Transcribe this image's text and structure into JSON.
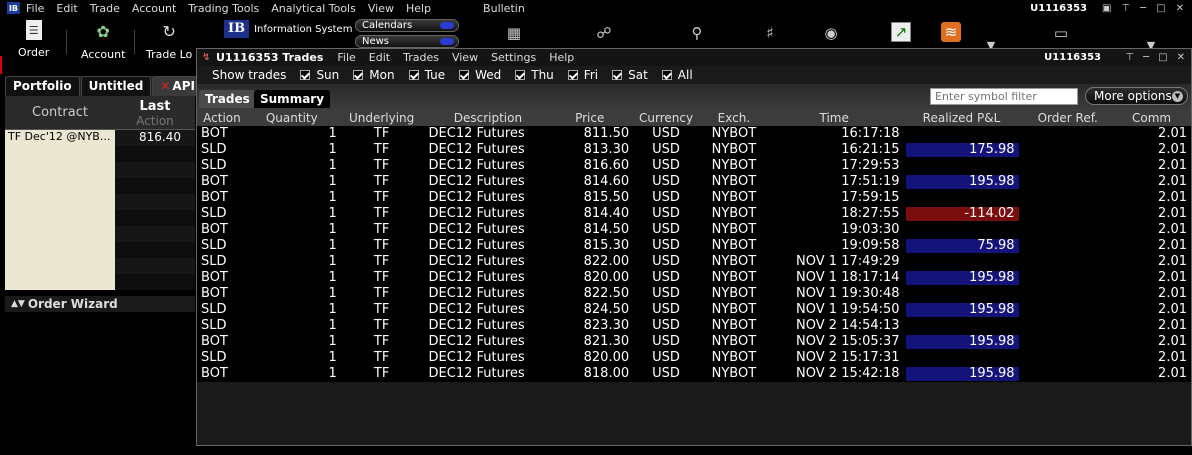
{
  "menubar": {
    "logo": "IB",
    "items": [
      "File",
      "Edit",
      "Trade",
      "Account",
      "Trading Tools",
      "Analytical Tools",
      "View",
      "Help"
    ],
    "bulletin": "Bulletin",
    "account": "U1116353"
  },
  "toolbar": {
    "order_label": "Order",
    "account_label": "Account",
    "tradelog_label": "Trade Lo",
    "ib_badge": "IB",
    "ib_info": "Information System",
    "calendars": "Calendars",
    "news": "News"
  },
  "left": {
    "tabs": [
      "Portfolio",
      "Untitled",
      "API"
    ],
    "header_contract": "Contract",
    "header_last": "Last",
    "header_action": "Action",
    "row_contract": "TF Dec'12 @NYB...",
    "row_last": "816.40",
    "order_wizard": "Order Wizard"
  },
  "trades_window": {
    "title": "U1116353 Trades",
    "menu": [
      "File",
      "Edit",
      "Trades",
      "View",
      "Settings",
      "Help"
    ],
    "account": "U1116353",
    "show_trades_label": "Show trades",
    "days": [
      "Sun",
      "Mon",
      "Tue",
      "Wed",
      "Thu",
      "Fri",
      "Sat",
      "All"
    ],
    "tabs": [
      "Trades",
      "Summary"
    ],
    "symbol_filter_placeholder": "Enter symbol filter",
    "more_options": "More options",
    "columns": [
      "Action",
      "Quantity",
      "Underlying",
      "Description",
      "Price",
      "Currency",
      "Exch.",
      "Time",
      "Realized P&L",
      "Order Ref.",
      "Comm"
    ],
    "rows": [
      {
        "action": "BOT",
        "qty": "1",
        "und": "TF",
        "desc": "DEC12 Futures",
        "price": "811.50",
        "cur": "USD",
        "exch": "NYBOT",
        "time": "16:17:18",
        "pnl": "",
        "ref": "",
        "comm": "2.01"
      },
      {
        "action": "SLD",
        "qty": "1",
        "und": "TF",
        "desc": "DEC12 Futures",
        "price": "813.30",
        "cur": "USD",
        "exch": "NYBOT",
        "time": "16:21:15",
        "pnl": "175.98",
        "ref": "",
        "comm": "2.01"
      },
      {
        "action": "SLD",
        "qty": "1",
        "und": "TF",
        "desc": "DEC12 Futures",
        "price": "816.60",
        "cur": "USD",
        "exch": "NYBOT",
        "time": "17:29:53",
        "pnl": "",
        "ref": "",
        "comm": "2.01"
      },
      {
        "action": "BOT",
        "qty": "1",
        "und": "TF",
        "desc": "DEC12 Futures",
        "price": "814.60",
        "cur": "USD",
        "exch": "NYBOT",
        "time": "17:51:19",
        "pnl": "195.98",
        "ref": "",
        "comm": "2.01"
      },
      {
        "action": "BOT",
        "qty": "1",
        "und": "TF",
        "desc": "DEC12 Futures",
        "price": "815.50",
        "cur": "USD",
        "exch": "NYBOT",
        "time": "17:59:15",
        "pnl": "",
        "ref": "",
        "comm": "2.01"
      },
      {
        "action": "SLD",
        "qty": "1",
        "und": "TF",
        "desc": "DEC12 Futures",
        "price": "814.40",
        "cur": "USD",
        "exch": "NYBOT",
        "time": "18:27:55",
        "pnl": "-114.02",
        "ref": "",
        "comm": "2.01"
      },
      {
        "action": "BOT",
        "qty": "1",
        "und": "TF",
        "desc": "DEC12 Futures",
        "price": "814.50",
        "cur": "USD",
        "exch": "NYBOT",
        "time": "19:03:30",
        "pnl": "",
        "ref": "",
        "comm": "2.01"
      },
      {
        "action": "SLD",
        "qty": "1",
        "und": "TF",
        "desc": "DEC12 Futures",
        "price": "815.30",
        "cur": "USD",
        "exch": "NYBOT",
        "time": "19:09:58",
        "pnl": "75.98",
        "ref": "",
        "comm": "2.01"
      },
      {
        "action": "SLD",
        "qty": "1",
        "und": "TF",
        "desc": "DEC12 Futures",
        "price": "822.00",
        "cur": "USD",
        "exch": "NYBOT",
        "time": "NOV 1 17:49:29",
        "pnl": "",
        "ref": "",
        "comm": "2.01"
      },
      {
        "action": "BOT",
        "qty": "1",
        "und": "TF",
        "desc": "DEC12 Futures",
        "price": "820.00",
        "cur": "USD",
        "exch": "NYBOT",
        "time": "NOV 1 18:17:14",
        "pnl": "195.98",
        "ref": "",
        "comm": "2.01"
      },
      {
        "action": "BOT",
        "qty": "1",
        "und": "TF",
        "desc": "DEC12 Futures",
        "price": "822.50",
        "cur": "USD",
        "exch": "NYBOT",
        "time": "NOV 1 19:30:48",
        "pnl": "",
        "ref": "",
        "comm": "2.01"
      },
      {
        "action": "SLD",
        "qty": "1",
        "und": "TF",
        "desc": "DEC12 Futures",
        "price": "824.50",
        "cur": "USD",
        "exch": "NYBOT",
        "time": "NOV 1 19:54:50",
        "pnl": "195.98",
        "ref": "",
        "comm": "2.01"
      },
      {
        "action": "SLD",
        "qty": "1",
        "und": "TF",
        "desc": "DEC12 Futures",
        "price": "823.30",
        "cur": "USD",
        "exch": "NYBOT",
        "time": "NOV 2 14:54:13",
        "pnl": "",
        "ref": "",
        "comm": "2.01"
      },
      {
        "action": "BOT",
        "qty": "1",
        "und": "TF",
        "desc": "DEC12 Futures",
        "price": "821.30",
        "cur": "USD",
        "exch": "NYBOT",
        "time": "NOV 2 15:05:37",
        "pnl": "195.98",
        "ref": "",
        "comm": "2.01"
      },
      {
        "action": "SLD",
        "qty": "1",
        "und": "TF",
        "desc": "DEC12 Futures",
        "price": "820.00",
        "cur": "USD",
        "exch": "NYBOT",
        "time": "NOV 2 15:17:31",
        "pnl": "",
        "ref": "",
        "comm": "2.01"
      },
      {
        "action": "BOT",
        "qty": "1",
        "und": "TF",
        "desc": "DEC12 Futures",
        "price": "818.00",
        "cur": "USD",
        "exch": "NYBOT",
        "time": "NOV 2 15:42:18",
        "pnl": "195.98",
        "ref": "",
        "comm": "2.01"
      }
    ]
  },
  "colors": {
    "pnl_positive_bg": "#13137a",
    "pnl_negative_bg": "#7a0d0d",
    "left_cell_bg": "#ebe7d2",
    "header_bg": "#3c3c3c"
  }
}
